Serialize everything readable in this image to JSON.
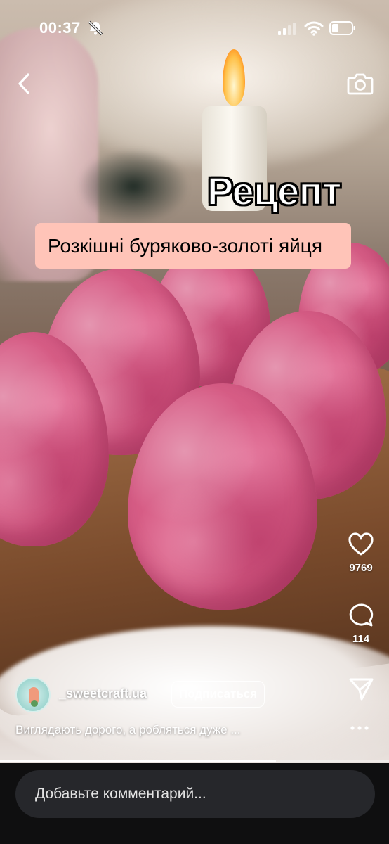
{
  "status_bar": {
    "time": "00:37",
    "icons": [
      "bell-slash-icon",
      "signal-icon",
      "wifi-icon",
      "battery-icon"
    ]
  },
  "top_nav": {
    "back_icon": "chevron-left-icon",
    "camera_icon": "camera-icon"
  },
  "overlay": {
    "title": "Рецепт",
    "subtitle": "Розкішні буряково-золоті яйця",
    "subtitle_bg": "#ffc4b8"
  },
  "actions": {
    "like": {
      "icon": "heart-icon",
      "count": "9769"
    },
    "comments": {
      "icon": "comment-icon",
      "count": "114"
    },
    "share": {
      "icon": "send-icon"
    }
  },
  "author": {
    "username": "_sweetcraft.ua",
    "subscribe_label": "Подписаться"
  },
  "caption": "Виглядають дорого, а робляться дуже ...",
  "more_icon": "more-horizontal-icon",
  "progress": {
    "fraction": 0.71
  },
  "comment_box": {
    "placeholder": "Добавьте комментарий..."
  },
  "colors": {
    "egg_pink": "#d75d86",
    "background_bottom": "#0f0f10"
  }
}
